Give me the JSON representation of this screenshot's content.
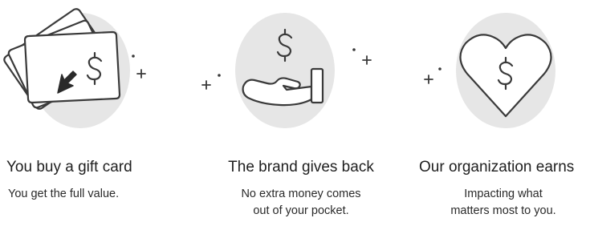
{
  "steps": [
    {
      "icon": "gift-card-cursor-icon",
      "title": "You buy a gift card",
      "description": [
        "You get the full value."
      ]
    },
    {
      "icon": "hand-giving-money-icon",
      "title": "The brand gives back",
      "description": [
        "No extra money comes",
        "out of your pocket."
      ]
    },
    {
      "icon": "heart-dollar-icon",
      "title": "Our organization earns",
      "description": [
        "Impacting what",
        "matters most to you."
      ]
    }
  ],
  "colors": {
    "circle": "#e6e6e6",
    "stroke": "#3a3a3a",
    "text": "#222222"
  }
}
